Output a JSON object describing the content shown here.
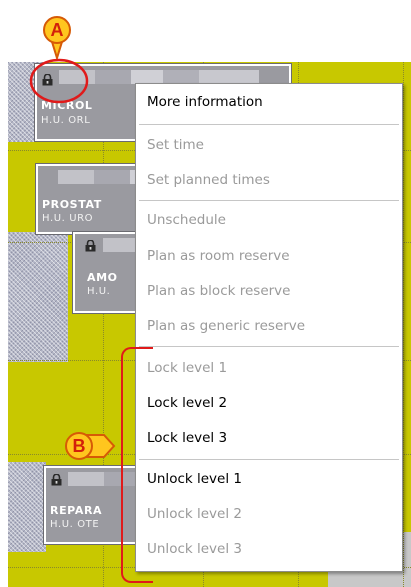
{
  "menu": {
    "items": [
      {
        "label": "More information",
        "enabled": true
      },
      {
        "label": "Set time",
        "enabled": false
      },
      {
        "label": "Set planned times",
        "enabled": false
      },
      {
        "label": "Unschedule",
        "enabled": false
      },
      {
        "label": "Plan as room reserve",
        "enabled": false
      },
      {
        "label": "Plan as block reserve",
        "enabled": false
      },
      {
        "label": "Plan as generic reserve",
        "enabled": false
      },
      {
        "label": "Lock level 1",
        "enabled": false
      },
      {
        "label": "Lock level 2",
        "enabled": true
      },
      {
        "label": "Lock level 3",
        "enabled": true
      },
      {
        "label": "Unlock level 1",
        "enabled": true
      },
      {
        "label": "Unlock level 2",
        "enabled": false
      },
      {
        "label": "Unlock level 3",
        "enabled": false
      }
    ]
  },
  "blocks": [
    {
      "procedure": "MICROL",
      "unit": "H.U. ORL",
      "locked": true
    },
    {
      "procedure": "PROSTAT",
      "unit": "H.U. URO",
      "locked": false
    },
    {
      "procedure": "AMO",
      "unit": "H.U.",
      "locked": true
    },
    {
      "procedure": "REPARA",
      "unit": "H.U. OTE",
      "locked": true
    }
  ],
  "callouts": {
    "a": "A",
    "b": "B"
  },
  "colors": {
    "scheduler_bg": "#c8c800",
    "callout_fill": "#ffc61e",
    "callout_text": "#d3200a",
    "highlight": "#e01a1a"
  },
  "icons": [
    "padlock-icon"
  ]
}
